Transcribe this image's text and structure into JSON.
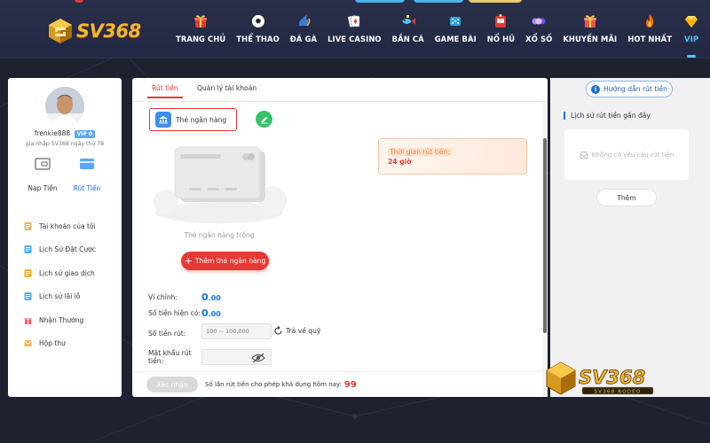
{
  "brand": {
    "name": "SV368",
    "watermark_name": "SV368",
    "watermark_sub": "SV368 RODEO"
  },
  "nav": {
    "items": [
      {
        "label": "TRANG CHỦ",
        "icon": "home-gift-icon"
      },
      {
        "label": "THỂ THAO",
        "icon": "soccer-ball-icon"
      },
      {
        "label": "ĐÁ GÀ",
        "icon": "rooster-icon"
      },
      {
        "label": "LIVE CASINO",
        "icon": "cards-icon"
      },
      {
        "label": "BẮN CÁ",
        "icon": "fish-icon"
      },
      {
        "label": "GAME BÀI",
        "icon": "dice-icon"
      },
      {
        "label": "NỔ HŨ",
        "icon": "slot-machine-icon"
      },
      {
        "label": "XỔ SỐ",
        "icon": "lottery-icon"
      },
      {
        "label": "KHUYẾN MÃI",
        "icon": "gift-icon"
      },
      {
        "label": "HOT NHẤT",
        "icon": "fire-icon"
      },
      {
        "label": "VIP",
        "icon": "diamond-icon"
      }
    ],
    "active_index": 10
  },
  "profile": {
    "username": "frenkie888",
    "vip_level": "VIP 0",
    "join_text": "gia nhập SV368 ngày thứ 78",
    "deposit_label": "Nạp Tiền",
    "withdraw_label": "Rút Tiền"
  },
  "menu": [
    {
      "label": "Tài khoản của tôi",
      "icon": "account-icon"
    },
    {
      "label": "Lịch Sử Đặt Cược",
      "icon": "bet-history-icon"
    },
    {
      "label": "Lịch sử giao dịch",
      "icon": "transaction-history-icon"
    },
    {
      "label": "Lịch sử lãi lỗ",
      "icon": "profit-loss-icon"
    },
    {
      "label": "Nhận Thưởng",
      "icon": "reward-icon"
    },
    {
      "label": "Hộp thư",
      "icon": "mailbox-icon"
    }
  ],
  "tabs": [
    {
      "label": "Rút tiền",
      "active": true
    },
    {
      "label": "Quản lý tài khoản",
      "active": false
    }
  ],
  "withdraw": {
    "bank_card_label": "Thẻ ngân hàng",
    "empty_text": "Thẻ ngân hàng trống",
    "add_bank_label": "Thêm thẻ ngân hàng",
    "time_label": "Thời gian rút tiền:",
    "time_value": "24 giờ",
    "wallet_label": "Ví chính:",
    "wallet_int": "0",
    "wallet_dec": ".00",
    "available_label": "Số tiền hiện có:",
    "available_int": "0",
    "available_dec": ".00",
    "amount_label": "Số tiền rút:",
    "amount_placeholder": "100 ~ 100,000",
    "return_fund_label": "Trả về quỹ",
    "password_label": "Mật khẩu rút tiền:",
    "password_placeholder": "",
    "confirm_label": "Xác nhận",
    "limit_text": "Số lần rút tiền cho phép khả dụng hôm nay:",
    "limit_value": "99"
  },
  "right": {
    "guide_label": "Hướng dẫn rút tiền",
    "guide_icon_glyph": "i",
    "history_title": "Lịch sử rút tiền gần đây",
    "history_empty": "Không có yêu cầu rút tiền",
    "more_label": "Thêm"
  },
  "colors": {
    "accent_red": "#e53935",
    "accent_blue": "#1e6fd9",
    "nav_bg": "#252a46",
    "brand_gold": "#f2b632"
  }
}
